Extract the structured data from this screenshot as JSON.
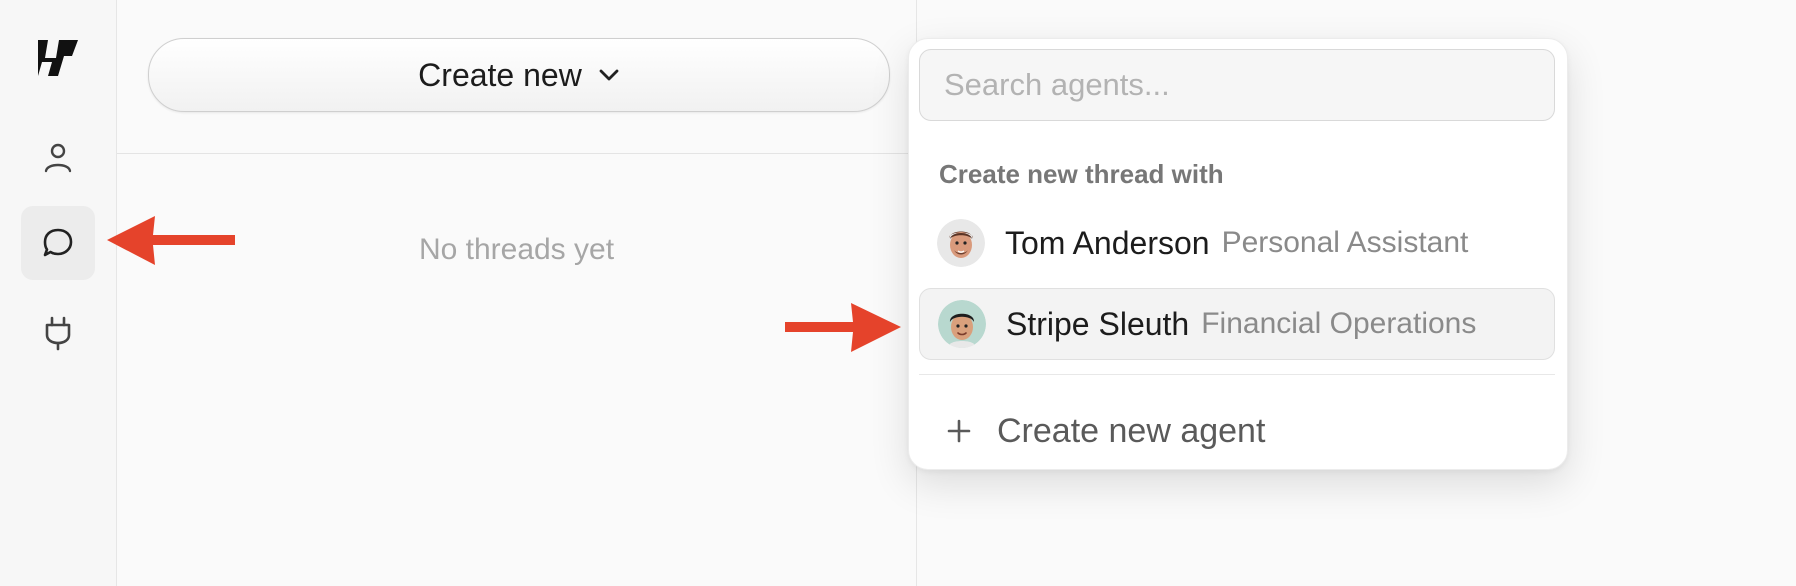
{
  "sidebar": {
    "logo": "workflow-logo",
    "items": [
      {
        "icon": "person-icon",
        "active": false
      },
      {
        "icon": "chat-bubble-icon",
        "active": true
      },
      {
        "icon": "plug-icon",
        "active": false
      }
    ]
  },
  "threads": {
    "create_button_label": "Create new",
    "empty_text": "No threads yet"
  },
  "dropdown": {
    "search_placeholder": "Search agents...",
    "section_label": "Create new thread with",
    "agents": [
      {
        "name": "Tom Anderson",
        "role": "Personal Assistant"
      },
      {
        "name": "Stripe Sleuth",
        "role": "Financial Operations"
      }
    ],
    "create_agent_label": "Create new agent"
  },
  "colors": {
    "arrow": "#e5432b",
    "active_rail": "#ececec",
    "avatar_bg_tom": "#e8e8e8",
    "avatar_bg_stripe": "#b8d8cf"
  }
}
